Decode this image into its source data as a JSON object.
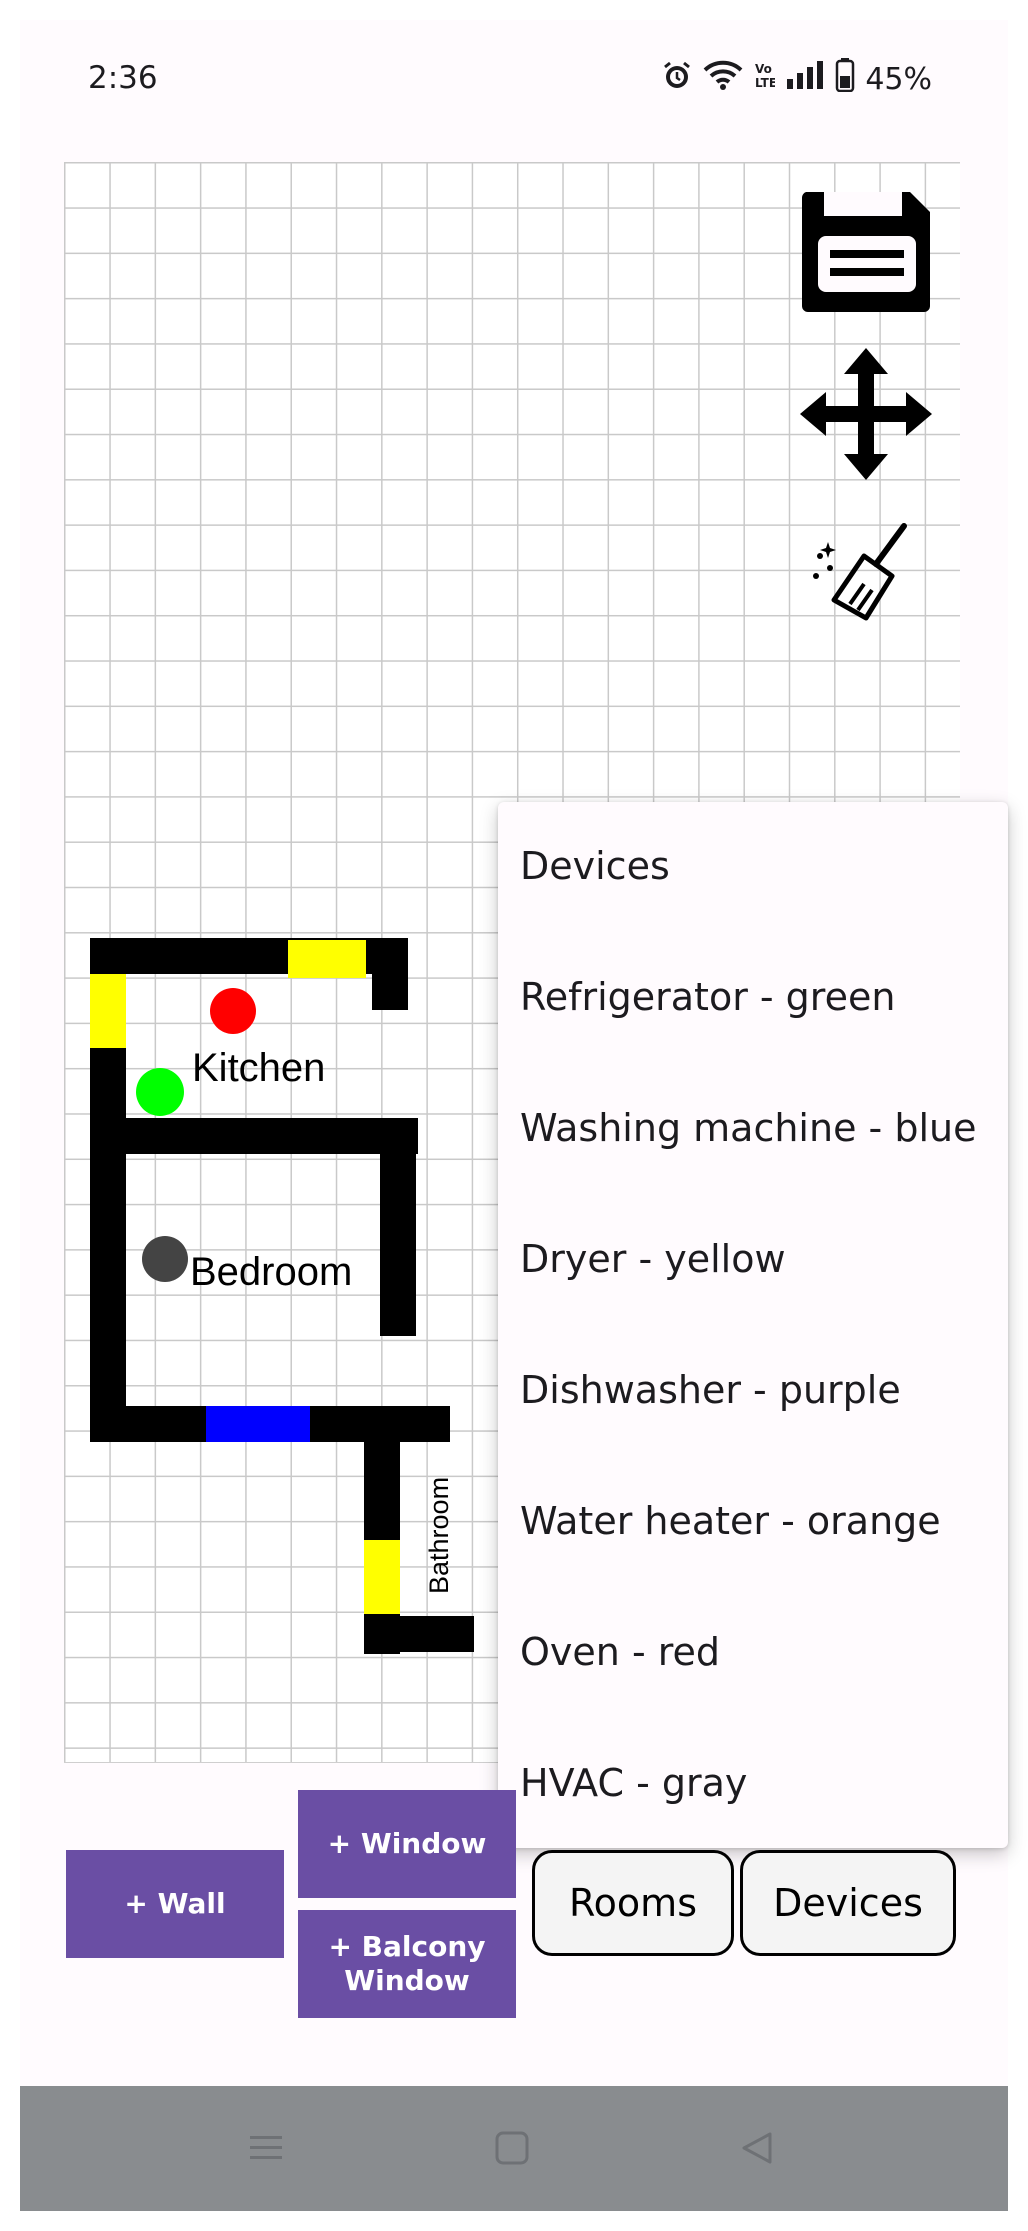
{
  "status_bar": {
    "time": "2:36",
    "battery": "45%",
    "icons": [
      "alarm-icon",
      "wifi-icon",
      "volte-icon",
      "signal-icon",
      "battery-icon"
    ]
  },
  "toolbar_icons": [
    "save-icon",
    "move-icon",
    "clear-broom-icon"
  ],
  "floor_plan": {
    "rooms": [
      "Kitchen",
      "Bedroom",
      "Bathroom"
    ],
    "colors": {
      "wall": "#000000",
      "window": "#ffff00",
      "balcony_window": "#0000ff",
      "refrigerator": "#00ff00",
      "oven": "#ff0000",
      "hvac": "#444444"
    }
  },
  "devices_menu": {
    "items": [
      "Devices",
      "Refrigerator - green",
      "Washing machine - blue",
      "Dryer - yellow",
      "Dishwasher - purple",
      "Water heater - orange",
      "Oven - red",
      "HVAC - gray"
    ]
  },
  "buttons": {
    "add_wall": "+ Wall",
    "add_window": "+ Window",
    "add_balcony_window_line1": "+ Balcony",
    "add_balcony_window_line2": "Window",
    "rooms": "Rooms",
    "devices": "Devices"
  },
  "accent_color": "#6a4ea4",
  "nav_bar": {
    "icons": [
      "menu-icon",
      "home-icon",
      "back-icon"
    ]
  }
}
